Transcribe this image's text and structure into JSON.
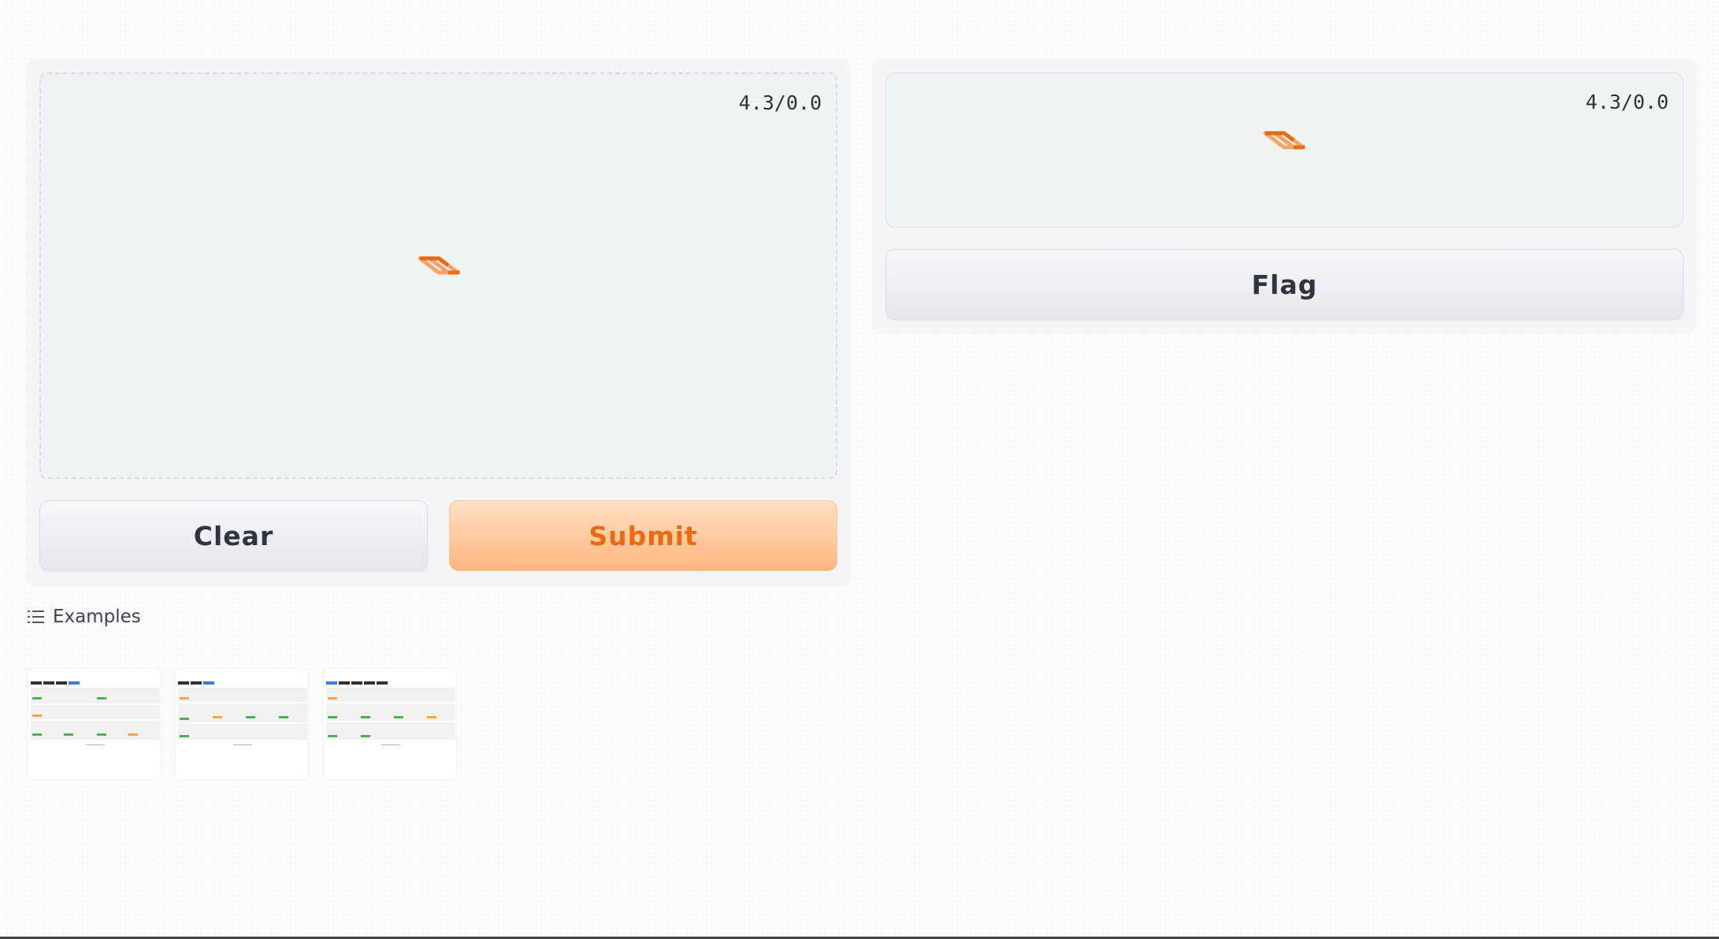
{
  "input": {
    "status": "4.3/0.0",
    "clear_label": "Clear",
    "submit_label": "Submit"
  },
  "output": {
    "status": "4.3/0.0",
    "flag_label": "Flag"
  },
  "examples": {
    "label": "Examples",
    "icon": "list-icon",
    "items": [
      {
        "name": "example-1"
      },
      {
        "name": "example-2"
      },
      {
        "name": "example-3"
      }
    ]
  },
  "colors": {
    "accent": "#ea6a0f",
    "primary_button_light": "#ffe0c3",
    "primary_button_dark": "#fdb67e"
  }
}
